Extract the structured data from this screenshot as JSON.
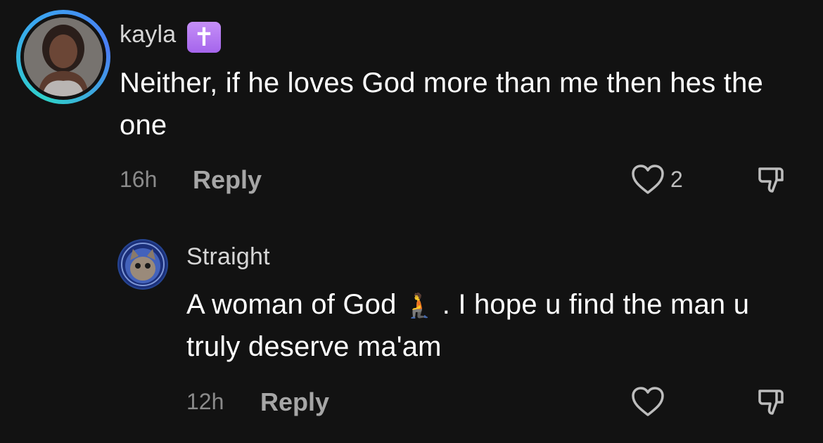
{
  "comments": [
    {
      "username": "kayla",
      "badge_icon": "latin-cross-icon",
      "badge_glyph": "✝",
      "text": "Neither, if he loves God more than me then hes the one",
      "time": "16h",
      "reply_label": "Reply",
      "like_count": "2"
    },
    {
      "username": "Straight",
      "text_before_emoji": "A woman of God",
      "emoji": "🧎",
      "text_after_emoji": ". I hope u find the man u truly deserve ma'am",
      "time": "12h",
      "reply_label": "Reply"
    }
  ]
}
